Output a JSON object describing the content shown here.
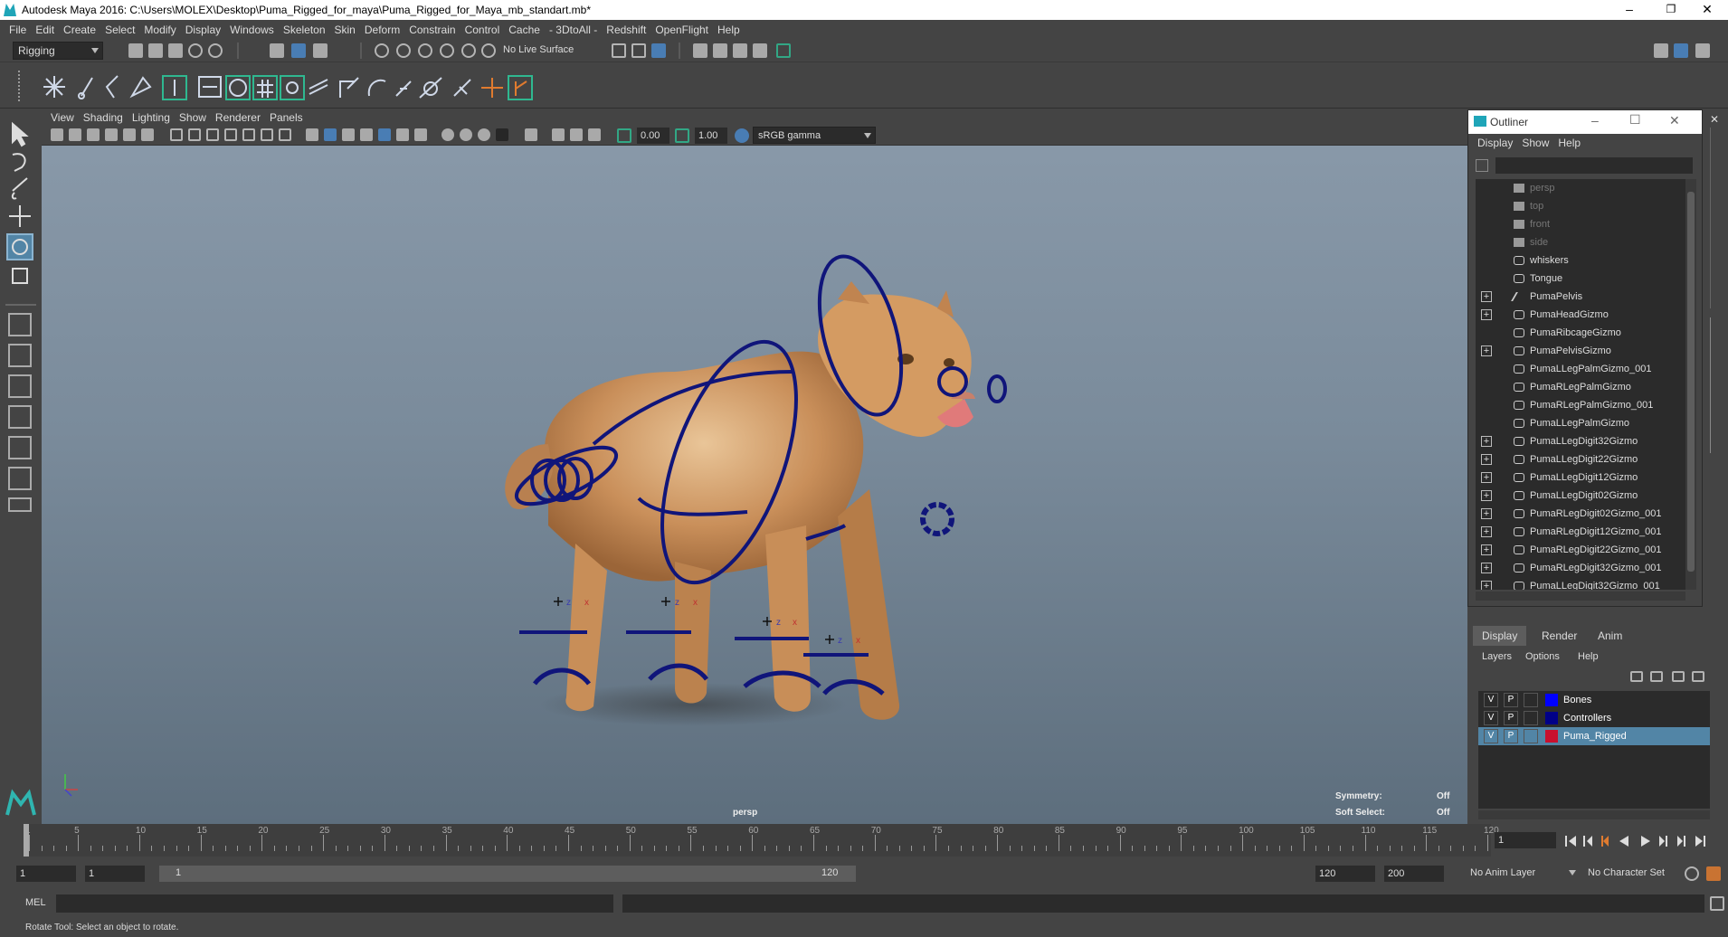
{
  "window": {
    "title": "Autodesk Maya 2016: C:\\Users\\MOLEX\\Desktop\\Puma_Rigged_for_maya\\Puma_Rigged_for_Maya_mb_standart.mb*",
    "minimize": "–",
    "restore": "❐",
    "close": "✕"
  },
  "menubar": [
    "File",
    "Edit",
    "Create",
    "Select",
    "Modify",
    "Display",
    "Windows",
    "Skeleton",
    "Skin",
    "Deform",
    "Constrain",
    "Control",
    "Cache",
    "- 3DtoAll -",
    "Redshift",
    "OpenFlight",
    "Help"
  ],
  "statusline": {
    "menu_set": "Rigging",
    "live_surface": "No Live Surface"
  },
  "panel": {
    "menus": [
      "View",
      "Shading",
      "Lighting",
      "Show",
      "Renderer",
      "Panels"
    ],
    "exposure": "0.00",
    "gamma": "1.00",
    "color_space": "sRGB gamma",
    "camera_label": "persp",
    "hud": {
      "symmetry_label": "Symmetry:",
      "symmetry_value": "Off",
      "soft_select_label": "Soft Select:",
      "soft_select_value": "Off"
    }
  },
  "outliner": {
    "title": "Outliner",
    "menus": [
      "Display",
      "Show",
      "Help"
    ],
    "items": [
      {
        "label": "persp",
        "expandable": false,
        "type": "camera",
        "dim": true
      },
      {
        "label": "top",
        "expandable": false,
        "type": "camera",
        "dim": true
      },
      {
        "label": "front",
        "expandable": false,
        "type": "camera",
        "dim": true
      },
      {
        "label": "side",
        "expandable": false,
        "type": "camera",
        "dim": true
      },
      {
        "label": "whiskers",
        "expandable": false,
        "type": "transform",
        "dim": false
      },
      {
        "label": "Tongue",
        "expandable": false,
        "type": "transform",
        "dim": false
      },
      {
        "label": "PumaPelvis",
        "expandable": true,
        "type": "joint",
        "dim": false
      },
      {
        "label": "PumaHeadGizmo",
        "expandable": true,
        "type": "transform",
        "dim": false
      },
      {
        "label": "PumaRibcageGizmo",
        "expandable": false,
        "type": "transform",
        "dim": false
      },
      {
        "label": "PumaPelvisGizmo",
        "expandable": true,
        "type": "transform",
        "dim": false
      },
      {
        "label": "PumaLLegPalmGizmo_001",
        "expandable": false,
        "type": "transform",
        "dim": false
      },
      {
        "label": "PumaRLegPalmGizmo",
        "expandable": false,
        "type": "transform",
        "dim": false
      },
      {
        "label": "PumaRLegPalmGizmo_001",
        "expandable": false,
        "type": "transform",
        "dim": false
      },
      {
        "label": "PumaLLegPalmGizmo",
        "expandable": false,
        "type": "transform",
        "dim": false
      },
      {
        "label": "PumaLLegDigit32Gizmo",
        "expandable": true,
        "type": "transform",
        "dim": false
      },
      {
        "label": "PumaLLegDigit22Gizmo",
        "expandable": true,
        "type": "transform",
        "dim": false
      },
      {
        "label": "PumaLLegDigit12Gizmo",
        "expandable": true,
        "type": "transform",
        "dim": false
      },
      {
        "label": "PumaLLegDigit02Gizmo",
        "expandable": true,
        "type": "transform",
        "dim": false
      },
      {
        "label": "PumaRLegDigit02Gizmo_001",
        "expandable": true,
        "type": "transform",
        "dim": false
      },
      {
        "label": "PumaRLegDigit12Gizmo_001",
        "expandable": true,
        "type": "transform",
        "dim": false
      },
      {
        "label": "PumaRLegDigit22Gizmo_001",
        "expandable": true,
        "type": "transform",
        "dim": false
      },
      {
        "label": "PumaRLegDigit32Gizmo_001",
        "expandable": true,
        "type": "transform",
        "dim": false
      },
      {
        "label": "PumaLLegDigit32Gizmo_001",
        "expandable": true,
        "type": "transform",
        "dim": false
      }
    ]
  },
  "layer_editor": {
    "tabs": [
      "Display",
      "Render",
      "Anim"
    ],
    "active_tab": "Display",
    "menus": [
      "Layers",
      "Options",
      "Help"
    ],
    "layers": [
      {
        "v": "V",
        "p": "P",
        "name": "Bones",
        "color": "#0000ff",
        "selected": false
      },
      {
        "v": "V",
        "p": "P",
        "name": "Controllers",
        "color": "#000088",
        "selected": false
      },
      {
        "v": "V",
        "p": "P",
        "name": "Puma_Rigged",
        "color": "#c8102e",
        "selected": true
      }
    ]
  },
  "timeline": {
    "ticks": [
      "1",
      "5",
      "10",
      "15",
      "20",
      "25",
      "30",
      "35",
      "40",
      "45",
      "50",
      "55",
      "60",
      "65",
      "70",
      "75",
      "80",
      "85",
      "90",
      "95",
      "100",
      "105",
      "110",
      "115",
      "120"
    ],
    "current_frame": "1"
  },
  "range": {
    "start": "1",
    "playback_start": "1",
    "slider_start": "1",
    "slider_end": "120",
    "playback_end": "120",
    "end": "200",
    "anim_layer": "No Anim Layer",
    "character_set": "No Character Set"
  },
  "command": {
    "language": "MEL",
    "help_text": "Rotate Tool: Select an object to rotate."
  },
  "colors": {
    "gizmo": "#10157a",
    "accent_teal": "#2fb890",
    "selected_row": "#5285a6"
  }
}
